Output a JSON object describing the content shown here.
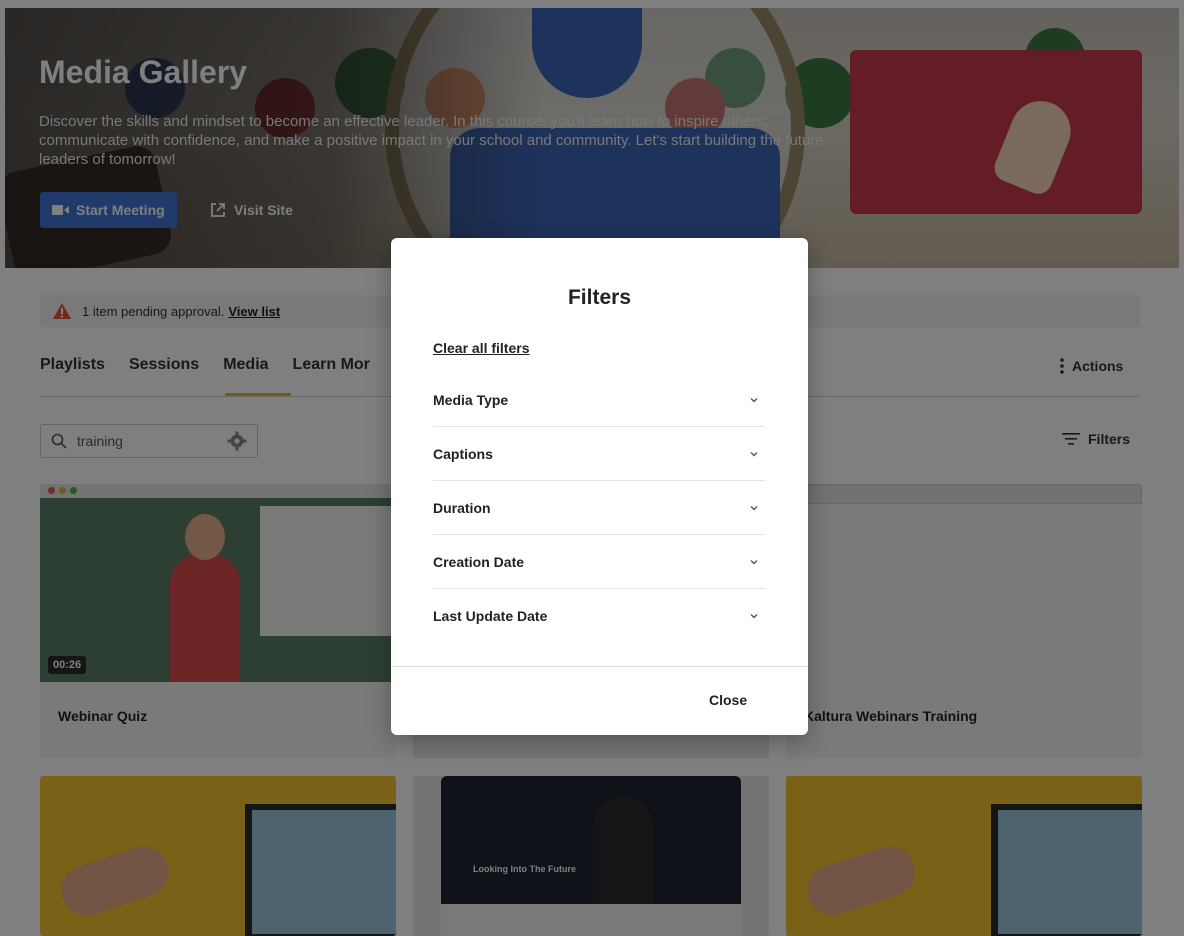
{
  "hero": {
    "title": "Media Gallery",
    "description": "Discover the skills and mindset to become an effective leader. In this course, you'll learn how to inspire others, communicate with confidence, and make a positive impact in your school and community. Let's start building the future leaders of tomorrow!",
    "start_meeting_label": "Start Meeting",
    "visit_site_label": "Visit Site"
  },
  "alert": {
    "text": "1 item pending approval.",
    "link_text": "View list"
  },
  "tabs": [
    {
      "label": "Playlists"
    },
    {
      "label": "Sessions"
    },
    {
      "label": "Media"
    },
    {
      "label": "Learn Mor"
    }
  ],
  "actions_label": "Actions",
  "search": {
    "value": "training"
  },
  "filters_label": "Filters",
  "cards": [
    {
      "title": "Webinar Quiz",
      "duration": "00:26"
    },
    {
      "title": "Kaltura Webinars Training"
    },
    {
      "overlay_text": "Looking Into The Future"
    }
  ],
  "modal": {
    "title": "Filters",
    "clear_label": "Clear all filters",
    "filters": [
      {
        "label": "Media Type"
      },
      {
        "label": "Captions"
      },
      {
        "label": "Duration"
      },
      {
        "label": "Creation Date"
      },
      {
        "label": "Last Update Date"
      }
    ],
    "close_label": "Close"
  },
  "colors": {
    "accent_blue": "#3f74d6",
    "tab_underline": "#e0b429",
    "promo_red": "#c93a4d",
    "warning": "#e8543a",
    "thumb_yellow": "#f2c230"
  },
  "icons": [
    "video-camera-icon",
    "external-link-icon",
    "warning-icon",
    "kebab-icon",
    "search-icon",
    "gear-icon",
    "filter-lines-icon",
    "chevron-down-icon"
  ]
}
